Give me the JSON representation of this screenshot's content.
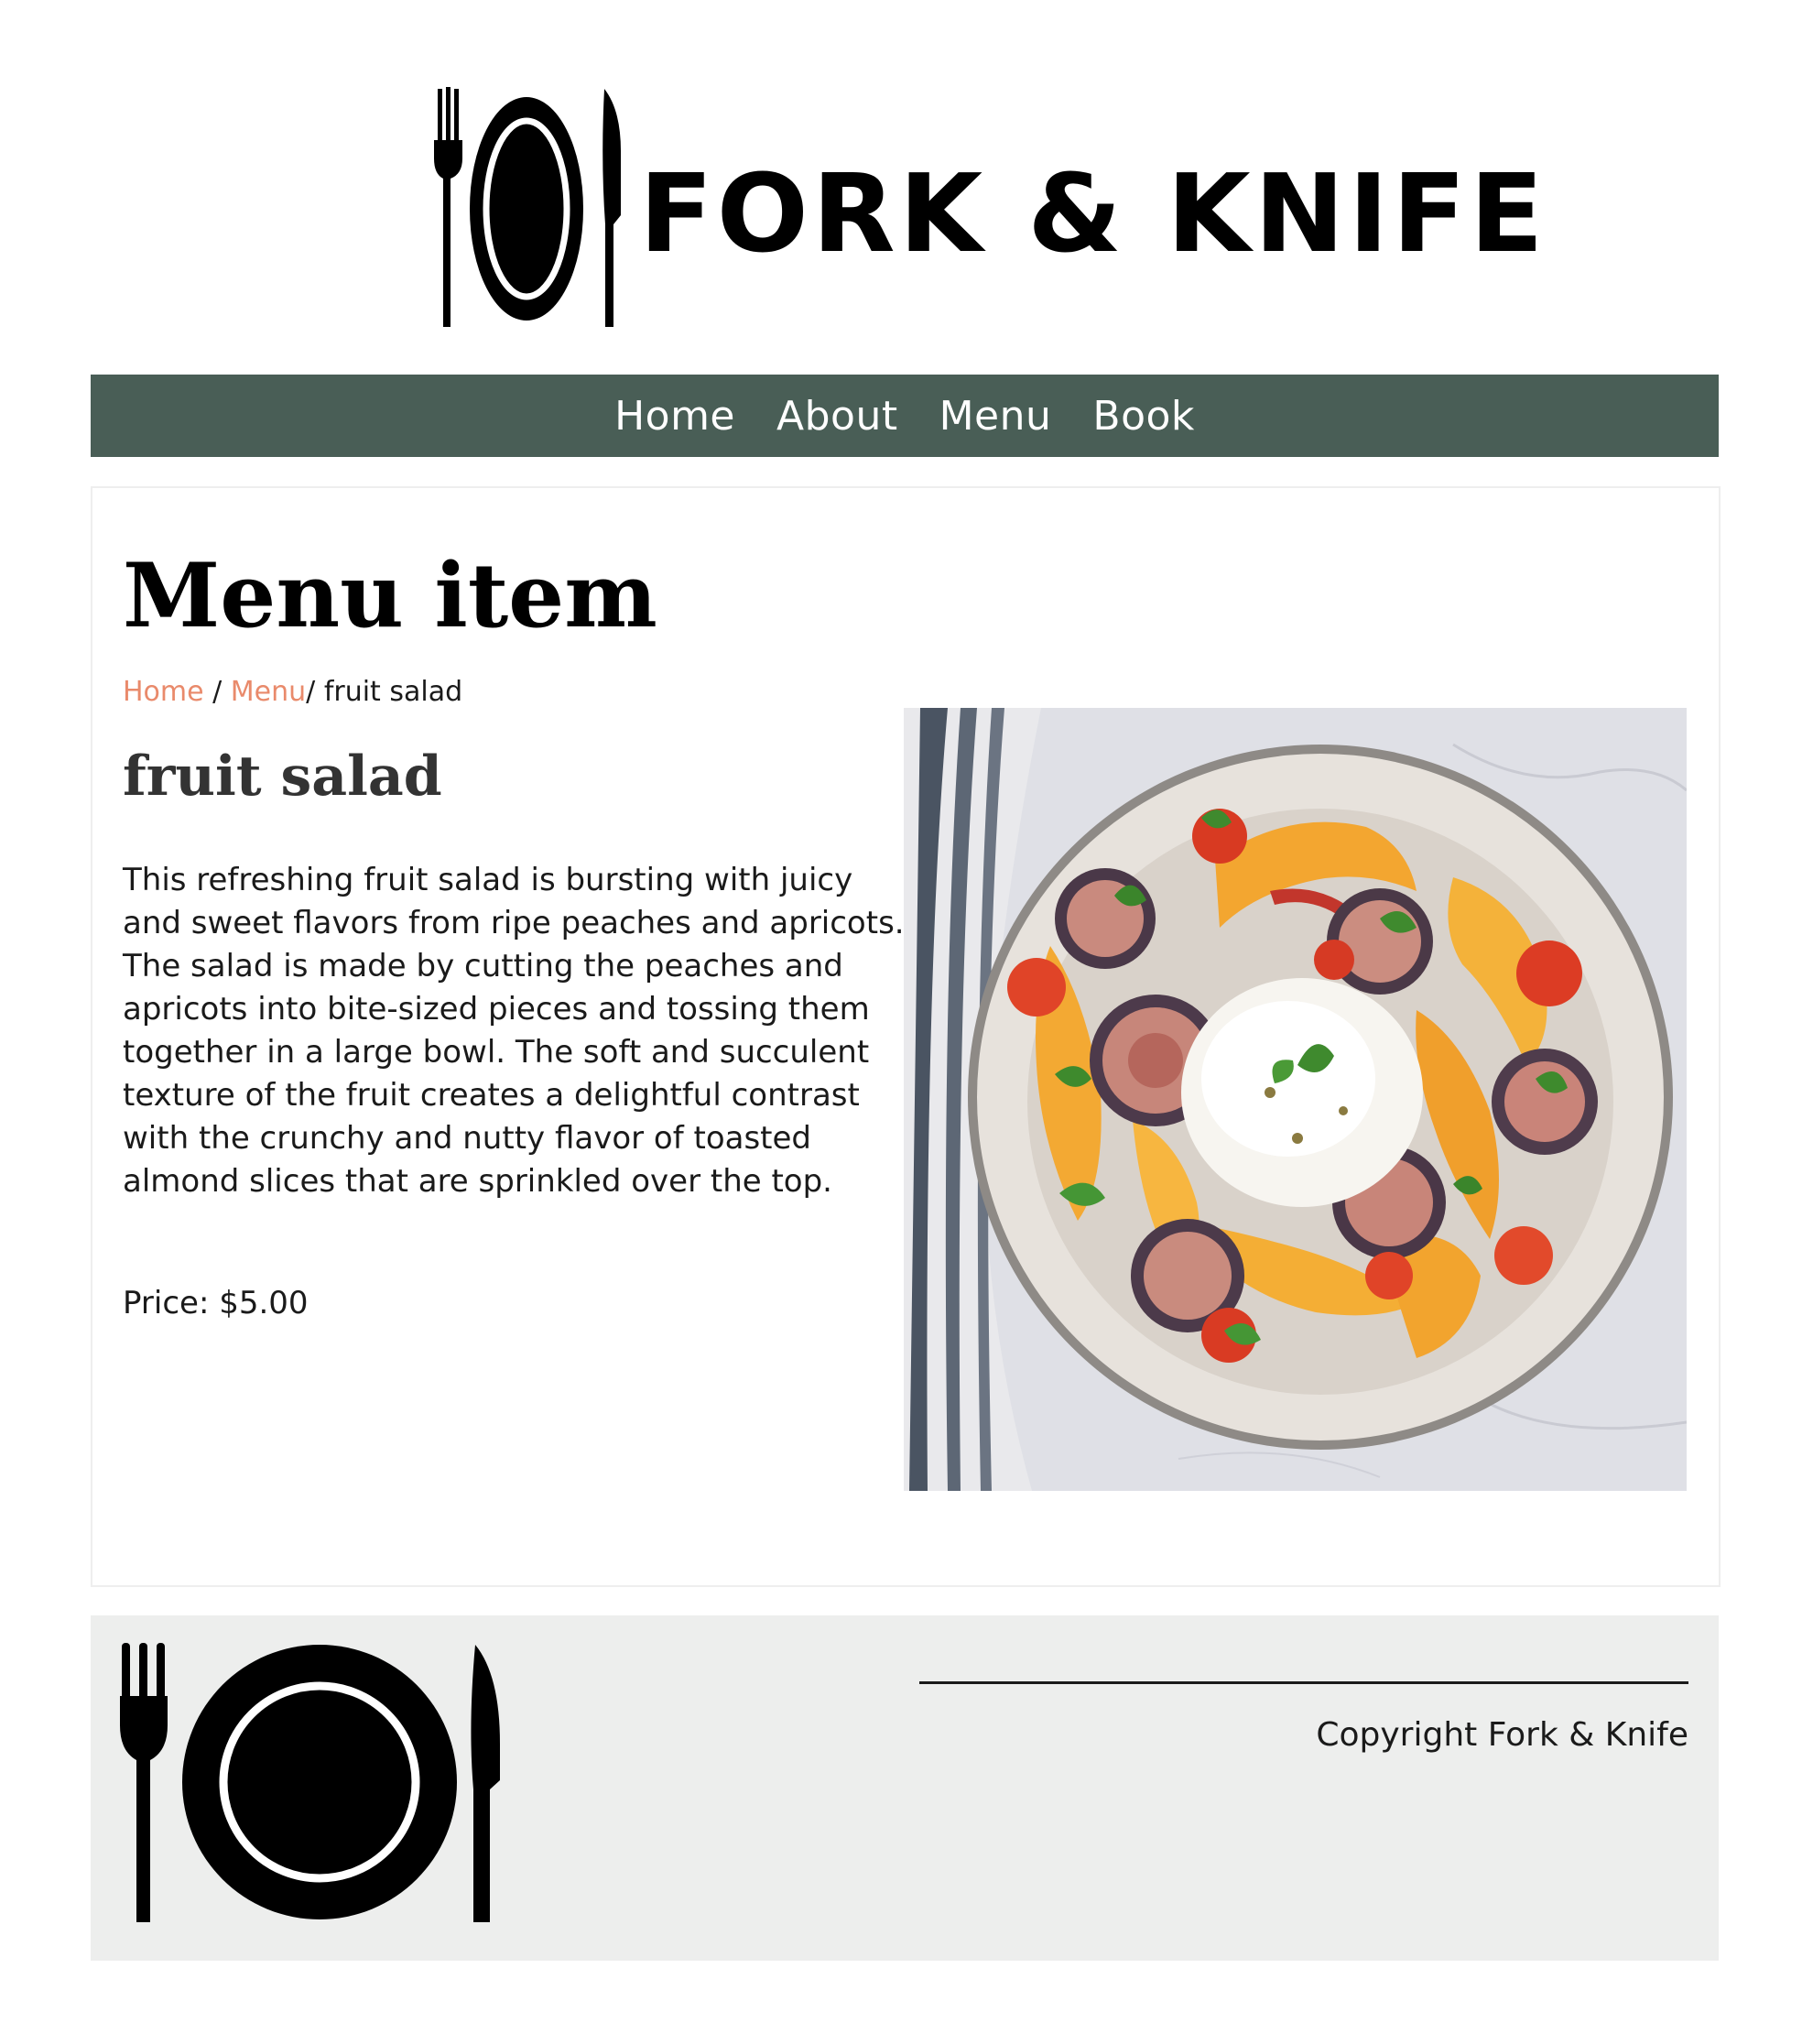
{
  "header": {
    "logo_text": "FORK & KNIFE",
    "logo_icon": "fork-plate-knife-icon"
  },
  "nav": {
    "items": [
      {
        "label": "Home"
      },
      {
        "label": "About"
      },
      {
        "label": "Menu"
      },
      {
        "label": "Book"
      }
    ],
    "background_color": "#495e56",
    "text_color": "#ffffff"
  },
  "main": {
    "page_title": "Menu item",
    "breadcrumb": {
      "home": "Home",
      "separator1": " / ",
      "menu": "Menu",
      "separator2": "/ ",
      "current": "fruit salad",
      "link_color": "#e98a6b"
    },
    "item": {
      "name": "fruit salad",
      "description": "This refreshing fruit salad is bursting with juicy and sweet flavors from ripe peaches and apricots. The salad is made by cutting the peaches and apricots into bite-sized pieces and tossing them together in a large bowl. The soft and succulent texture of the fruit creates a delightful contrast with the crunchy and nutty flavor of toasted almond slices that are sprinkled over the top.",
      "price": "Price: $5.00",
      "image_icon": "fruit-salad-photo"
    }
  },
  "footer": {
    "logo_icon": "fork-plate-knife-icon",
    "copyright": "Copyright Fork & Knife",
    "background_color": "#edeeed"
  }
}
